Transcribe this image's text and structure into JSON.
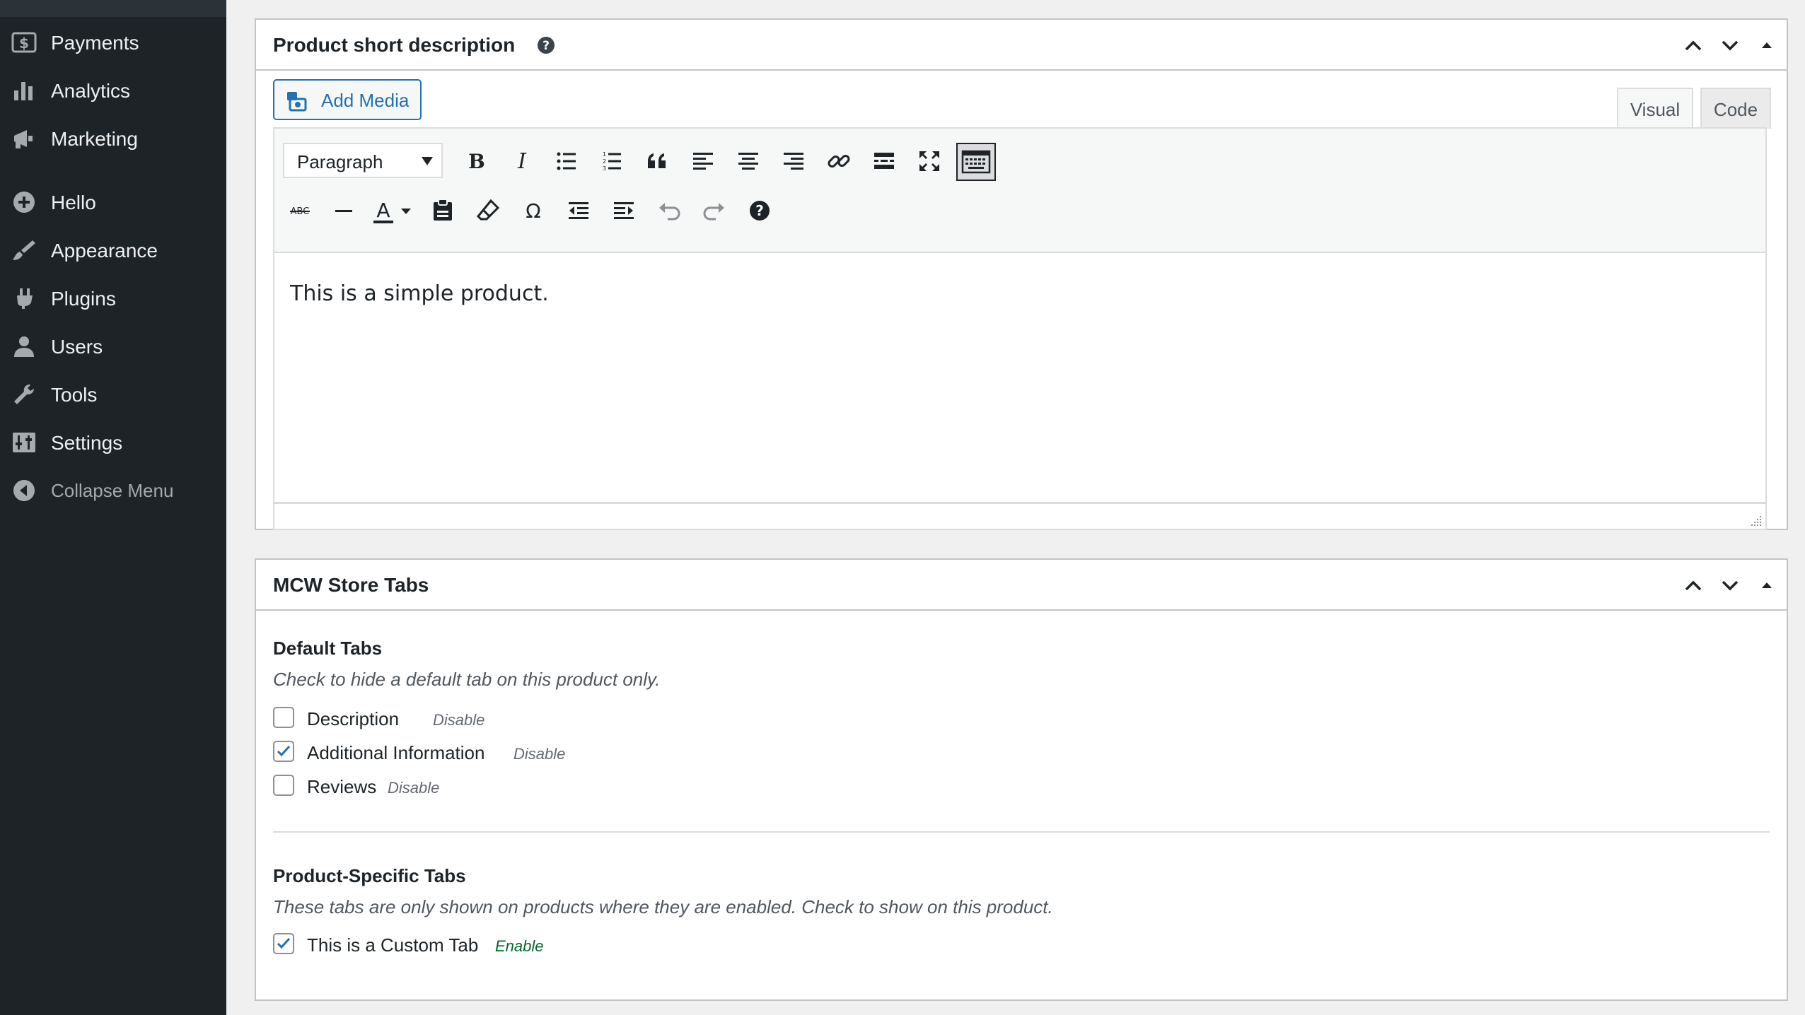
{
  "sidebar": {
    "items": [
      {
        "label": "Payments",
        "icon": "dollar-icon"
      },
      {
        "label": "Analytics",
        "icon": "bar-chart-icon"
      },
      {
        "label": "Marketing",
        "icon": "megaphone-icon"
      },
      {
        "label": "Hello",
        "icon": "plus-circle-icon"
      },
      {
        "label": "Appearance",
        "icon": "paintbrush-icon"
      },
      {
        "label": "Plugins",
        "icon": "plug-icon"
      },
      {
        "label": "Users",
        "icon": "user-icon"
      },
      {
        "label": "Tools",
        "icon": "wrench-icon"
      },
      {
        "label": "Settings",
        "icon": "sliders-icon"
      }
    ],
    "collapse_label": "Collapse Menu"
  },
  "short_description": {
    "title": "Product short description",
    "add_media_label": "Add Media",
    "tab_visual": "Visual",
    "tab_code": "Code",
    "format_select_value": "Paragraph",
    "content": "This is a simple product."
  },
  "store_tabs": {
    "title": "MCW Store Tabs",
    "default_tabs_title": "Default Tabs",
    "default_tabs_desc": "Check to hide a default tab on this product only.",
    "default_tabs": [
      {
        "label": "Description",
        "note": "Disable",
        "checked": false
      },
      {
        "label": "Additional Information",
        "note": "Disable",
        "checked": true
      },
      {
        "label": "Reviews",
        "note": "Disable",
        "checked": false
      }
    ],
    "specific_tabs_title": "Product-Specific Tabs",
    "specific_tabs_desc": "These tabs are only shown on products where they are enabled. Check to show on this product.",
    "specific_tabs": [
      {
        "label": "This is a Custom Tab",
        "note": "Enable",
        "checked": true
      }
    ]
  },
  "colors": {
    "sidebar_bg": "#1d2327",
    "accent_blue": "#2271b1",
    "enable_green": "#00692c"
  }
}
